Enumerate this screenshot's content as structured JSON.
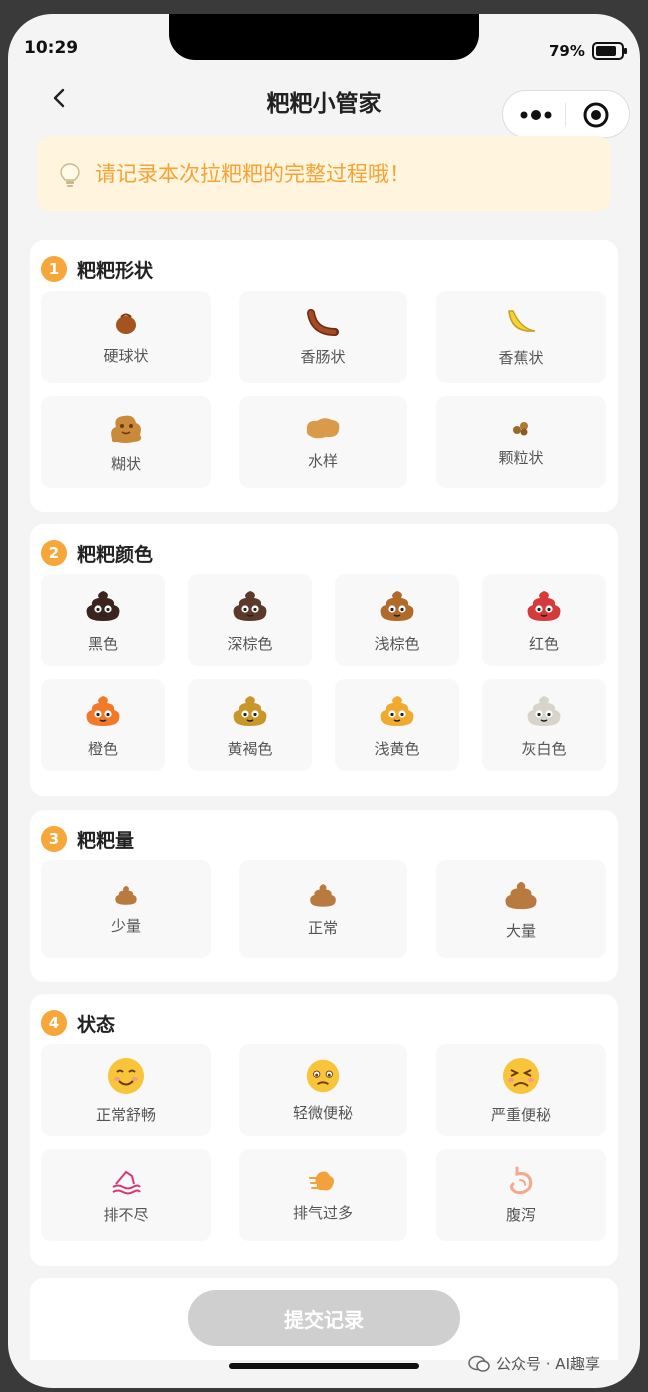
{
  "status_bar": {
    "time": "10:29",
    "battery": "79%"
  },
  "nav": {
    "title": "粑粑小管家"
  },
  "tip": {
    "text": "请记录本次拉粑粑的完整过程哦！"
  },
  "sections": {
    "shape": {
      "number": "1",
      "title": "粑粑形状",
      "options": [
        "硬球状",
        "香肠状",
        "香蕉状",
        "糊状",
        "水样",
        "颗粒状"
      ]
    },
    "color": {
      "number": "2",
      "title": "粑粑颜色",
      "options": [
        "黑色",
        "深棕色",
        "浅棕色",
        "红色",
        "橙色",
        "黄褐色",
        "浅黄色",
        "灰白色"
      ],
      "swatches": [
        "#3b2420",
        "#5b3a2a",
        "#b06a2a",
        "#d63a3a",
        "#f07a2a",
        "#c9962a",
        "#f0aa30",
        "#d8d4cc"
      ]
    },
    "amount": {
      "number": "3",
      "title": "粑粑量",
      "options": [
        "少量",
        "正常",
        "大量"
      ]
    },
    "state": {
      "number": "4",
      "title": "状态",
      "options": [
        "正常舒畅",
        "轻微便秘",
        "严重便秘",
        "排不尽",
        "排气过多",
        "腹泻"
      ]
    }
  },
  "submit": {
    "label": "提交记录"
  },
  "watermark": {
    "text": "公众号 · AI趣享"
  },
  "colors": {
    "accent": "#f7a63a",
    "tip_bg": "#fff4de",
    "tip_text": "#f5a334",
    "button_disabled": "#cfcfcf"
  }
}
